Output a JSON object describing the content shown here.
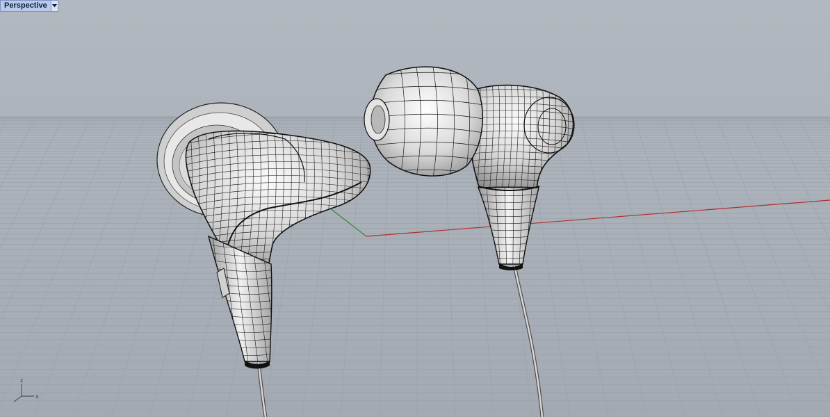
{
  "viewport": {
    "name": "Perspective",
    "menu_icon": "chevron-down-icon"
  },
  "gizmo": {
    "z_label": "z",
    "x_label": "x"
  },
  "scene": {
    "background_color": "#a8aeb6",
    "grid_color": "#9aa1aa",
    "x_axis_color": "#b03030",
    "y_axis_color": "#2e8a2e",
    "objects": [
      {
        "name": "earbud-left"
      },
      {
        "name": "earbud-right"
      }
    ]
  }
}
